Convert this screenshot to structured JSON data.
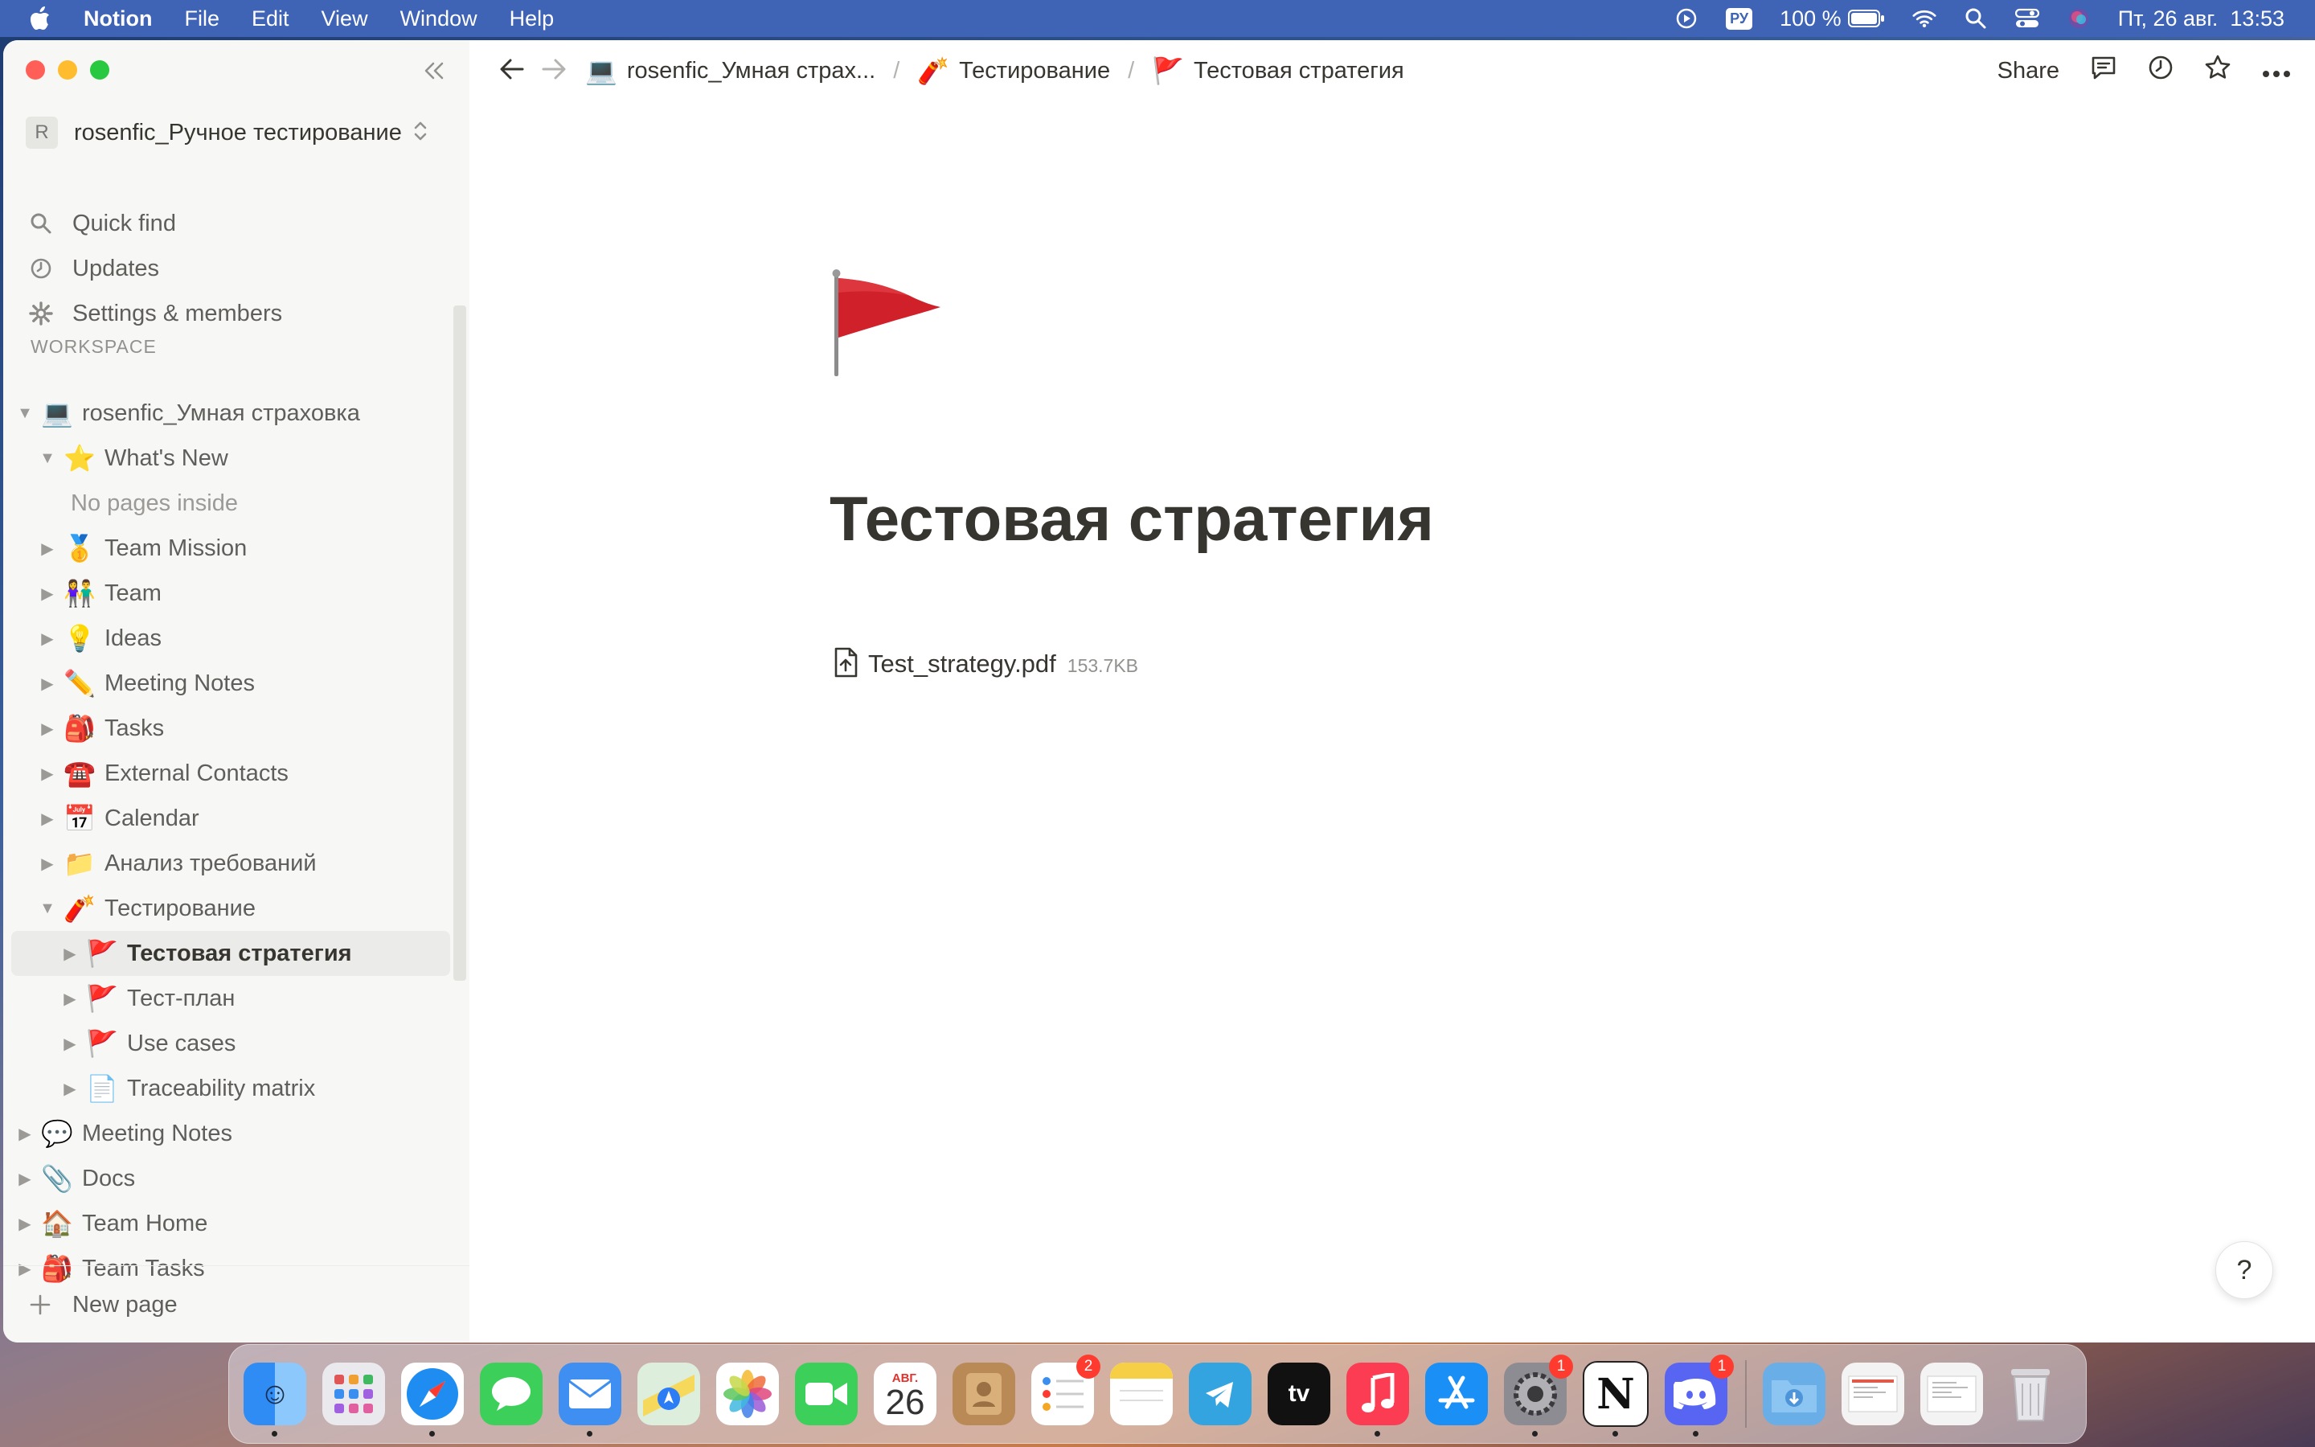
{
  "menubar": {
    "app_name": "Notion",
    "menus": [
      "File",
      "Edit",
      "View",
      "Window",
      "Help"
    ],
    "keyboard_layout": "РУ",
    "battery": "100 %",
    "datetime": "Пт, 26 авг.  13:53"
  },
  "sidebar": {
    "workspace_avatar": "R",
    "workspace_name": "rosenfic_Ручное тестирование",
    "nav": [
      "Quick find",
      "Updates",
      "Settings & members"
    ],
    "section_title": "WORKSPACE",
    "tree": [
      {
        "emoji": "💻",
        "label": "rosenfic_Умная страховка"
      },
      {
        "emoji": "⭐",
        "label": "What's New"
      },
      {
        "emoji": "",
        "label": "No pages inside"
      },
      {
        "emoji": "🥇",
        "label": "Team Mission"
      },
      {
        "emoji": "👫",
        "label": "Team"
      },
      {
        "emoji": "💡",
        "label": "Ideas"
      },
      {
        "emoji": "✏️",
        "label": "Meeting Notes"
      },
      {
        "emoji": "🎒",
        "label": "Tasks"
      },
      {
        "emoji": "☎️",
        "label": "External Contacts"
      },
      {
        "emoji": "📅",
        "label": "Calendar"
      },
      {
        "emoji": "📁",
        "label": "Анализ требований"
      },
      {
        "emoji": "🧨",
        "label": "Тестирование"
      },
      {
        "emoji": "🚩",
        "label": "Тестовая стратегия"
      },
      {
        "emoji": "🚩",
        "label": "Тест-план"
      },
      {
        "emoji": "🚩",
        "label": "Use cases"
      },
      {
        "emoji": "📄",
        "label": "Traceability matrix"
      },
      {
        "emoji": "💬",
        "label": "Meeting Notes"
      },
      {
        "emoji": "📎",
        "label": "Docs"
      },
      {
        "emoji": "🏠",
        "label": "Team Home"
      },
      {
        "emoji": "🎒",
        "label": "Team Tasks"
      }
    ],
    "new_page": "New page"
  },
  "topbar": {
    "breadcrumbs": [
      {
        "emoji": "💻",
        "label": "rosenfic_Умная страх..."
      },
      {
        "emoji": "🧨",
        "label": "Тестирование"
      },
      {
        "emoji": "🚩",
        "label": "Тестовая стратегия"
      }
    ],
    "share": "Share"
  },
  "page": {
    "icon": "red-flag",
    "title": "Тестовая стратегия",
    "file": {
      "name": "Test_strategy.pdf",
      "size": "153.7KB"
    },
    "help": "?"
  },
  "dock": {
    "calendar_month": "АВГ.",
    "calendar_day": "26",
    "badges": {
      "reminders": "2",
      "system_settings": "1",
      "discord": "1"
    }
  },
  "colors": {
    "menubar": "#3f63b5",
    "sidebar_bg": "#f7f7f5",
    "text_primary": "#37352f",
    "text_secondary": "#5f5e5b",
    "selected_row": "#ebebea",
    "flag_red": "#d0212b"
  }
}
